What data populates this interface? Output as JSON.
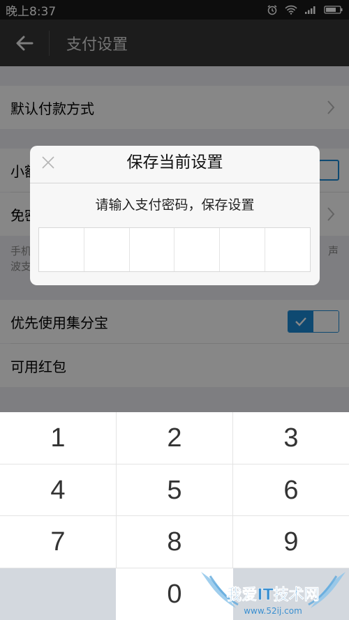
{
  "status_bar": {
    "time": "晚上8:37",
    "icons": [
      "alarm-icon",
      "wifi-icon",
      "signal-icon",
      "battery-icon"
    ]
  },
  "header": {
    "title": "支付设置",
    "back_icon": "back-arrow-icon"
  },
  "settings": {
    "default_payment": "默认付款方式",
    "small_amount": "小额",
    "password_free": "免密",
    "hint_line1": "手机",
    "hint_line1_end": "声",
    "hint_line2": "波支",
    "prefer_jifenbao": "优先使用集分宝",
    "available_red_packet": "可用红包"
  },
  "dialog": {
    "title": "保存当前设置",
    "prompt": "请输入支付密码，保存设置",
    "pin_length": 6
  },
  "keypad": {
    "keys": [
      "1",
      "2",
      "3",
      "4",
      "5",
      "6",
      "7",
      "8",
      "9",
      "",
      "0",
      ""
    ]
  },
  "watermark": {
    "text": "我爱IT技术网",
    "url": "www.52ij.com"
  },
  "colors": {
    "accent": "#1b8ad6",
    "header": "#353535",
    "statusbar": "#1a1a1a"
  }
}
